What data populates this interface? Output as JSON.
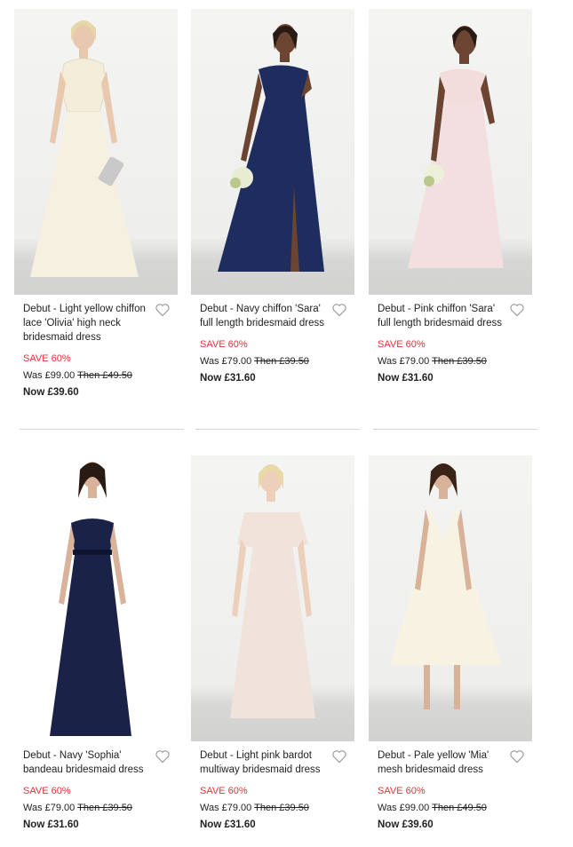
{
  "colors": {
    "sale_red": "#e8303a",
    "text": "#222222",
    "divider": "#d4d4d4",
    "backdrop": "#f2f2f0"
  },
  "products": [
    {
      "title": "Debut - Light yellow chiffon lace 'Olivia' high neck bridesmaid dress",
      "save": "SAVE 60%",
      "was_label": "Was £99.00",
      "then_label": "Then £49.50",
      "now_label": "Now £39.60",
      "dress_color": "#f5f0df",
      "wishlist_icon": "heart-outline-icon"
    },
    {
      "title": "Debut - Navy chiffon 'Sara' full length bridesmaid dress",
      "save": "SAVE 60%",
      "was_label": "Was £79.00",
      "then_label": "Then £39.50",
      "now_label": "Now £31.60",
      "dress_color": "#1f2c5e",
      "wishlist_icon": "heart-outline-icon"
    },
    {
      "title": "Debut - Pink chiffon 'Sara' full length bridesmaid dress",
      "save": "SAVE 60%",
      "was_label": "Was £79.00",
      "then_label": "Then £39.50",
      "now_label": "Now £31.60",
      "dress_color": "#f4dfe0",
      "wishlist_icon": "heart-outline-icon"
    },
    {
      "title": "Debut - Navy 'Sophia' bandeau bridesmaid dress",
      "save": "SAVE 60%",
      "was_label": "Was £79.00",
      "then_label": "Then £39.50",
      "now_label": "Now £31.60",
      "dress_color": "#1a2347",
      "wishlist_icon": "heart-outline-icon"
    },
    {
      "title": "Debut - Light pink bardot multiway bridesmaid dress",
      "save": "SAVE 60%",
      "was_label": "Was £79.00",
      "then_label": "Then £39.50",
      "now_label": "Now £31.60",
      "dress_color": "#efe3dc",
      "wishlist_icon": "heart-outline-icon"
    },
    {
      "title": "Debut - Pale yellow 'Mia' mesh bridesmaid dress",
      "save": "SAVE 60%",
      "was_label": "Was £99.00",
      "then_label": "Then £49.50",
      "now_label": "Now £39.60",
      "dress_color": "#f7f2e2",
      "wishlist_icon": "heart-outline-icon"
    }
  ]
}
